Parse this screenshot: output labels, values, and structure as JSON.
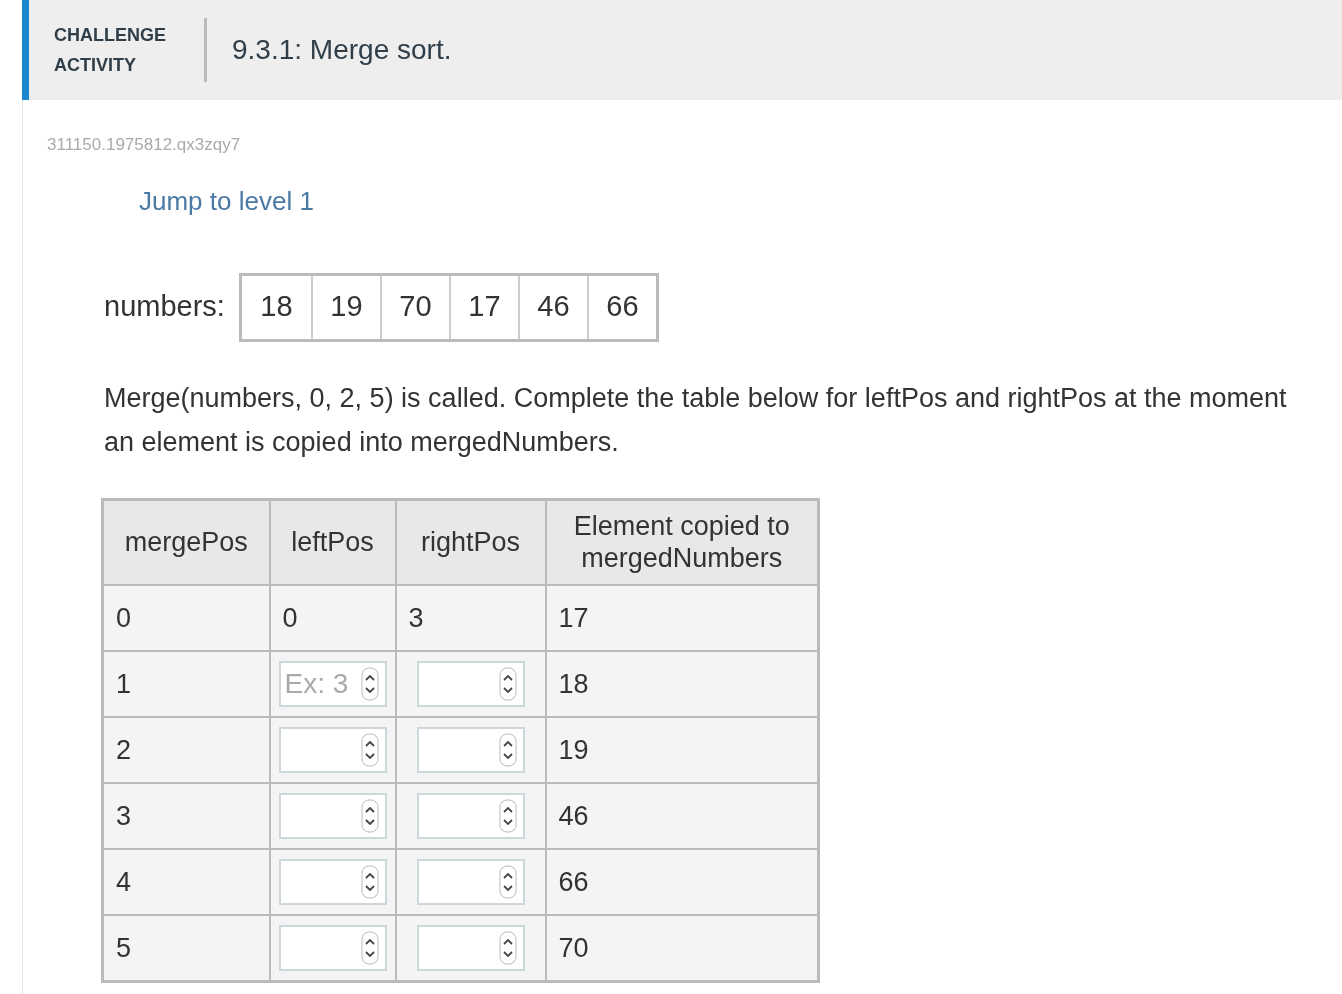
{
  "header": {
    "label": "CHALLENGE ACTIVITY",
    "title": "9.3.1: Merge sort."
  },
  "activity_id": "311150.1975812.qx3zqy7",
  "jump_link": "Jump to level 1",
  "array": {
    "label": "numbers:",
    "values": [
      "18",
      "19",
      "70",
      "17",
      "46",
      "66"
    ]
  },
  "prompt": "Merge(numbers, 0, 2, 5) is called. Complete the table below for leftPos and rightPos at the moment an element is copied into mergedNumbers.",
  "table": {
    "columns": [
      "mergePos",
      "leftPos",
      "rightPos",
      "Element copied to mergedNumbers"
    ],
    "rows": [
      {
        "kind": "given",
        "mergePos": "0",
        "leftPos": "0",
        "rightPos": "3",
        "element": "17"
      },
      {
        "kind": "input",
        "mergePos": "1",
        "leftPos_placeholder": "Ex: 3",
        "element": "18"
      },
      {
        "kind": "input",
        "mergePos": "2",
        "element": "19"
      },
      {
        "kind": "input",
        "mergePos": "3",
        "element": "46"
      },
      {
        "kind": "input",
        "mergePos": "4",
        "element": "66"
      },
      {
        "kind": "input",
        "mergePos": "5",
        "element": "70"
      }
    ]
  }
}
